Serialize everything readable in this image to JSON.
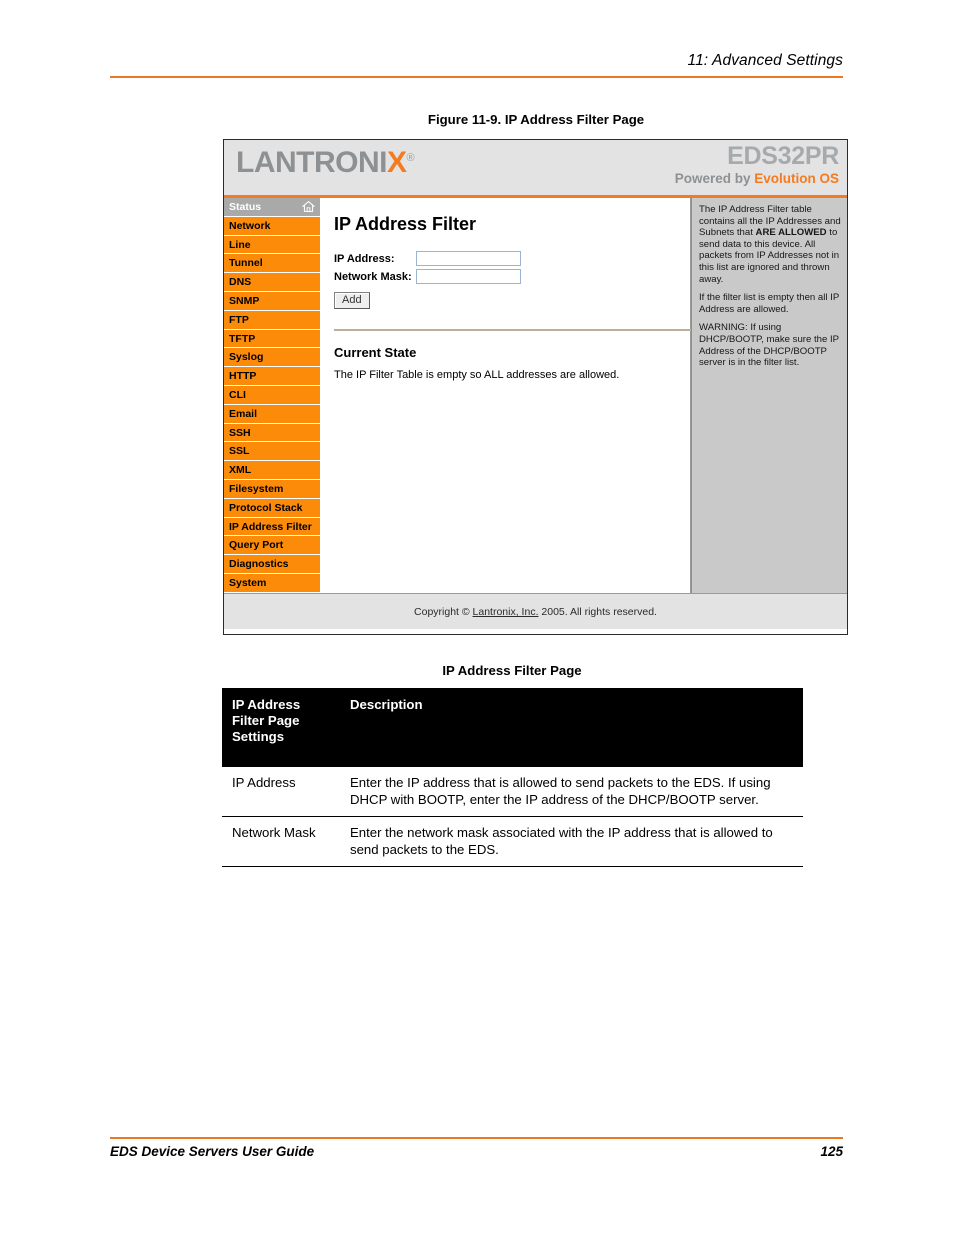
{
  "page": {
    "running_header": "11: Advanced Settings",
    "figure_caption": "Figure 11-9. IP Address Filter Page",
    "footer_title": "EDS Device Servers User Guide",
    "footer_page_number": "125",
    "accent_color": "#ef7622"
  },
  "screenshot": {
    "banner": {
      "logo_text_gray": "LANTRONI",
      "logo_text_orange": "X",
      "logo_registered": "®",
      "model_name": "EDS32PR",
      "powered_by_prefix": "Powered by ",
      "powered_by_brand": "Evolution OS",
      "brand_orange": "#f47b20",
      "logo_gray": "#8e9193"
    },
    "sidebar": {
      "active_item": "Status",
      "items": [
        {
          "label": "Status",
          "active": true,
          "icon": "home-icon"
        },
        {
          "label": "Network",
          "active": false
        },
        {
          "label": "Line",
          "active": false
        },
        {
          "label": "Tunnel",
          "active": false
        },
        {
          "label": "DNS",
          "active": false
        },
        {
          "label": "SNMP",
          "active": false
        },
        {
          "label": "FTP",
          "active": false
        },
        {
          "label": "TFTP",
          "active": false
        },
        {
          "label": "Syslog",
          "active": false
        },
        {
          "label": "HTTP",
          "active": false
        },
        {
          "label": "CLI",
          "active": false
        },
        {
          "label": "Email",
          "active": false
        },
        {
          "label": "SSH",
          "active": false
        },
        {
          "label": "SSL",
          "active": false
        },
        {
          "label": "XML",
          "active": false
        },
        {
          "label": "Filesystem",
          "active": false
        },
        {
          "label": "Protocol Stack",
          "active": false
        },
        {
          "label": "IP Address Filter",
          "active": false
        },
        {
          "label": "Query Port",
          "active": false
        },
        {
          "label": "Diagnostics",
          "active": false
        },
        {
          "label": "System",
          "active": false
        }
      ],
      "item_color": "#fc8b09",
      "active_color": "#a9a9a9"
    },
    "content": {
      "title": "IP Address Filter",
      "fields": [
        {
          "label": "IP Address:",
          "value": "",
          "placeholder": ""
        },
        {
          "label": "Network Mask:",
          "value": "",
          "placeholder": ""
        }
      ],
      "add_button": "Add",
      "current_state_title": "Current State",
      "current_state_text": "The IP Filter Table is empty so ALL addresses are allowed."
    },
    "help": {
      "paragraph1_a": "The IP Address Filter table contains all the IP Addresses and Subnets that ",
      "paragraph1_bold": "ARE ALLOWED",
      "paragraph1_b": " to send data to this device. All packets from IP Addresses not in this list are ignored and thrown away.",
      "paragraph2": "If the filter list is empty then all IP Address are allowed.",
      "paragraph3": "WARNING: If using DHCP/BOOTP, make sure the IP Address of the DHCP/BOOTP server is in the filter list."
    },
    "footer": {
      "copyright_prefix": "Copyright © ",
      "copyright_link": "Lantronix, Inc.",
      "copyright_suffix": " 2005. All rights reserved."
    }
  },
  "settings_table": {
    "title": "IP Address Filter Page",
    "headers": [
      "IP Address Filter Page Settings",
      "Description"
    ],
    "rows": [
      {
        "setting": "IP Address",
        "description": "Enter the IP address that is allowed to send packets to the EDS. If using DHCP with BOOTP, enter the IP address of the DHCP/BOOTP server."
      },
      {
        "setting": "Network Mask",
        "description": "Enter the network mask associated with the IP address that is allowed to send packets to the EDS."
      }
    ]
  }
}
